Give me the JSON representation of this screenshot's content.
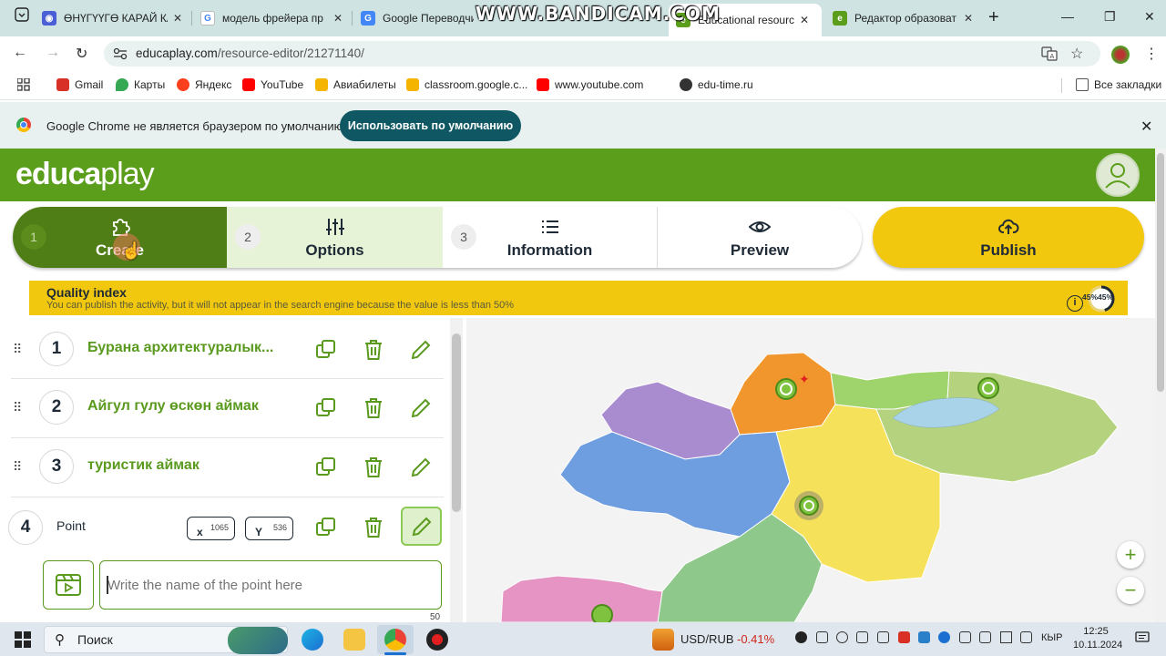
{
  "browser": {
    "tabs": [
      {
        "title": "ӨНҮГҮҮГӨ КАРАЙ КА",
        "favicon_color": "#4a5fd6",
        "active": false
      },
      {
        "title": "модель фрейера пр",
        "favicon_color": "#4285f4",
        "active": false
      },
      {
        "title": "Google Переводчик",
        "favicon_color": "#4285f4",
        "active": false
      },
      {
        "title": "Educational resource",
        "favicon_color": "#5b9e1b",
        "active": true
      },
      {
        "title": "Редактор образоват",
        "favicon_color": "#5b9e1b",
        "active": false
      }
    ],
    "watermark": "WWW.BANDICAM.COM",
    "url_host": "educaplay.com",
    "url_path": "/resource-editor/21271140/",
    "bookmarks": [
      {
        "label": "Gmail",
        "color": "#d93025"
      },
      {
        "label": "Карты",
        "color": "#34a853"
      },
      {
        "label": "Яндекс",
        "color": "#fc3f1d"
      },
      {
        "label": "YouTube",
        "color": "#ff0000"
      },
      {
        "label": "Авиабилеты",
        "color": "#f4b400"
      },
      {
        "label": "classroom.google.c...",
        "color": "#f4b400"
      },
      {
        "label": "www.youtube.com",
        "color": "#ff0000"
      },
      {
        "label": "edu-time.ru",
        "color": "#e8452c"
      }
    ],
    "all_bookmarks_label": "Все закладки",
    "infobar_text": "Google Chrome не является браузером по умолчанию.",
    "infobar_button": "Использовать по умолчанию"
  },
  "app": {
    "logo_bold": "educa",
    "logo_light": "play",
    "steps": [
      {
        "num": "1",
        "label": "Create",
        "icon": "puzzle-icon"
      },
      {
        "num": "2",
        "label": "Options",
        "icon": "sliders-icon"
      },
      {
        "num": "3",
        "label": "Information",
        "icon": "list-icon"
      },
      {
        "num": "",
        "label": "Preview",
        "icon": "eye-icon"
      }
    ],
    "publish_label": "Publish",
    "quality": {
      "title": "Quality index",
      "subtitle": "You can publish the activity, but it will not appear in the search engine because the value is less than 50%",
      "value_text": "45%45%",
      "value_fraction": 0.45
    },
    "points": [
      {
        "num": "1",
        "title": "Бурана архитектуралык..."
      },
      {
        "num": "2",
        "title": "Айгул гулу өскөн аймак"
      },
      {
        "num": "3",
        "title": "туристик аймак"
      }
    ],
    "editing_point": {
      "num": "4",
      "label": "Point",
      "x_label": "x",
      "x_value": "1065",
      "y_label": "Y",
      "y_value": "536",
      "name_placeholder": "Write the name of the point here",
      "char_limit": "50"
    },
    "map_zoom_in": "+",
    "map_zoom_out": "−",
    "colors": {
      "brand_green": "#5b9e1b",
      "publish_yellow": "#f2c80f",
      "title_green": "#5a9a1e"
    }
  },
  "taskbar": {
    "search_label": "Поиск",
    "ticker_label": "USD/RUB",
    "ticker_value": "-0.41%",
    "language": "КЫР",
    "time": "12:25",
    "date": "10.11.2024"
  }
}
